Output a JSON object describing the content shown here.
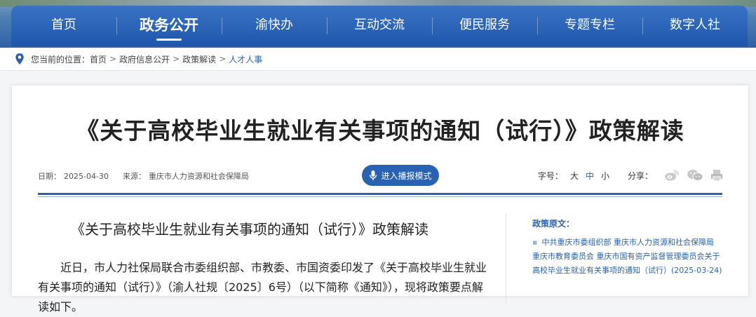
{
  "nav": {
    "items": [
      {
        "label": "首页",
        "active": false
      },
      {
        "label": "政务公开",
        "active": true
      },
      {
        "label": "渝快办",
        "active": false
      },
      {
        "label": "互动交流",
        "active": false
      },
      {
        "label": "便民服务",
        "active": false
      },
      {
        "label": "专题专栏",
        "active": false
      },
      {
        "label": "数字人社",
        "active": false
      }
    ]
  },
  "breadcrumb": {
    "prefix": "您当前的位置：",
    "items": [
      "首页",
      "政府信息公开",
      "政策解读",
      "人才人事"
    ],
    "separator": ">"
  },
  "article": {
    "title": "《关于高校毕业生就业有关事项的通知（试行）》政策解读",
    "date_label": "日期：",
    "date": "2025-04-30",
    "source_label": "来源：",
    "source": "重庆市人力资源和社会保障局",
    "broadcast_button": "进入播报模式",
    "font_size_label": "字号：",
    "font_sizes": [
      "大",
      "中",
      "小"
    ],
    "font_size_selected": "中",
    "share_label": "分享：",
    "share_icons": [
      "weibo-icon",
      "wechat-icon",
      "print-icon"
    ],
    "body_title": "《关于高校毕业生就业有关事项的通知（试行）》政策解读",
    "body_paragraph": "近日，市人力社保局联合市委组织部、市教委、市国资委印发了《关于高校毕业生就业有关事项的通知（试行）》（渝人社规〔2025〕6号）（以下简称《通知》），现将政策要点解读如下。"
  },
  "sidebar": {
    "heading": "政策原文：",
    "link": "中共重庆市委组织部 重庆市人力资源和社会保障局 重庆市教育委员会 重庆市国有资产监督管理委员会关于高校毕业生就业有关事项的通知（试行）(2025-03-24)"
  },
  "colors": {
    "primary": "#2a62b3",
    "nav_bg": "#1f56ac"
  }
}
